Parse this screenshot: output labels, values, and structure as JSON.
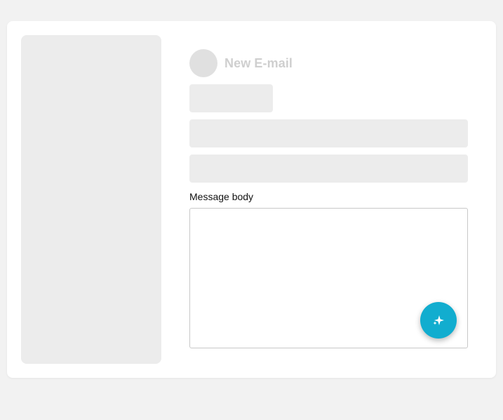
{
  "compose": {
    "title": "New E-mail",
    "body_label": "Message body",
    "body_value": "",
    "body_placeholder": ""
  },
  "fab": {
    "icon": "sparkles-icon",
    "color": "#12adcf"
  },
  "colors": {
    "page_background": "#f2f2f2",
    "card_background": "#ffffff",
    "skeleton": "#ececec"
  }
}
